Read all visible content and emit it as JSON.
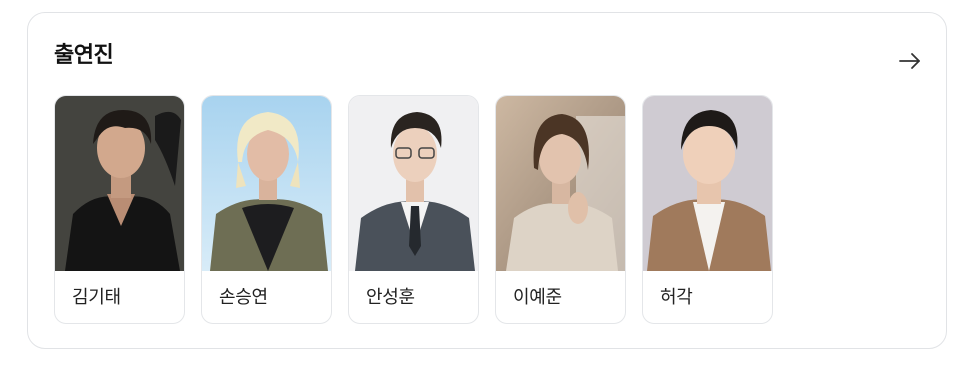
{
  "section": {
    "title": "출연진",
    "more_icon": "arrow-right-icon"
  },
  "cast": [
    {
      "name": "김기태"
    },
    {
      "name": "손승연"
    },
    {
      "name": "안성훈"
    },
    {
      "name": "이예준"
    },
    {
      "name": "허각"
    }
  ],
  "colors": {
    "border": "#e1e3e6",
    "title": "#111111",
    "name": "#222222"
  }
}
